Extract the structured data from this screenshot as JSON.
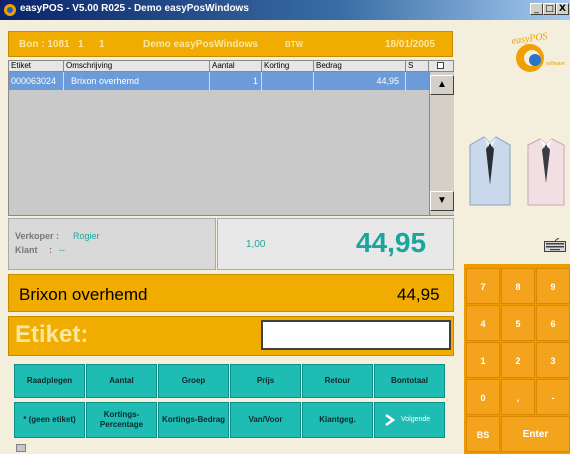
{
  "window": {
    "title": "easyPOS - V5.00 R025 - Demo easyPosWindows",
    "controls": {
      "minimize": "_",
      "maximize": "□",
      "close": "X"
    }
  },
  "header": {
    "bon_label": "Bon : 1081",
    "col2": "1",
    "col3": "1",
    "shop": "Demo easyPosWindows",
    "btw": "BTW",
    "date": "18/01/2005"
  },
  "logo": {
    "text_top": "easyPOS",
    "text_bottom": "software"
  },
  "table": {
    "headers": [
      "Etiket",
      "Omschrijving",
      "Aantal",
      "Korting",
      "Bedrag",
      "S"
    ],
    "rows": [
      {
        "etiket": "000063024",
        "omschrijving": "Brixon overhemd",
        "aantal": "1",
        "korting": "",
        "bedrag": "44,95",
        "s": ""
      }
    ]
  },
  "seller": {
    "verkoper_label": "Verkoper :",
    "verkoper_value": "Rogier",
    "klant_label": "Klant",
    "klant_sep": ":",
    "klant_value": "--"
  },
  "totals": {
    "qty": "1,00",
    "amount": "44,95"
  },
  "item": {
    "name": "Brixon overhemd",
    "price": "44,95"
  },
  "etiket": {
    "label": "Etiket:",
    "value": ""
  },
  "buttons": {
    "row1": [
      "Raadplegen",
      "Aantal",
      "Groep",
      "Prijs",
      "Retour",
      "Bontotaal"
    ],
    "row2": [
      "* (geen etiket)",
      "Kortings-Percentage",
      "Kortings-Bedrag",
      "Van/Voor",
      "Klantgeg.",
      "Volgende"
    ]
  },
  "numpad": {
    "keys": [
      "7",
      "8",
      "9",
      "4",
      "5",
      "6",
      "1",
      "2",
      "3",
      "0",
      ",",
      "-"
    ],
    "bs": "BS",
    "enter": "Enter"
  },
  "colors": {
    "accent": "#f0ac00",
    "teal": "#1fbcb4",
    "total": "#1aa59d",
    "selection": "#6b9bd8"
  }
}
